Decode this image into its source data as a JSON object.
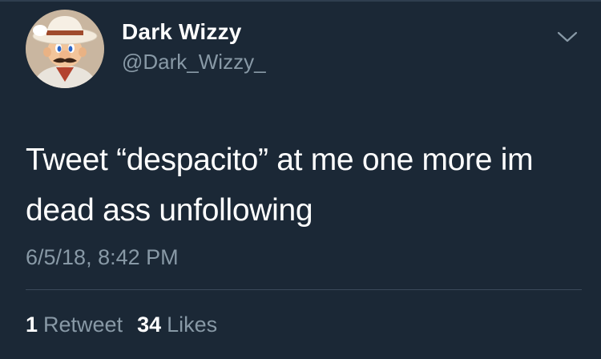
{
  "tweet": {
    "author": {
      "display_name": "Dark Wizzy",
      "handle": "@Dark_Wizzy_",
      "avatar_icon": "cowboy-mario-avatar"
    },
    "menu_icon": "chevron-down-icon",
    "text": "Tweet “despacito” at me one more im dead ass unfollowing",
    "timestamp": "6/5/18, 8:42 PM",
    "stats": {
      "retweets_count": "1",
      "retweets_label": "Retweet",
      "likes_count": "34",
      "likes_label": "Likes"
    }
  },
  "colors": {
    "background": "#1b2836",
    "primary_text": "#ffffff",
    "secondary_text": "#8899a6",
    "divider": "#3b4a5a"
  }
}
